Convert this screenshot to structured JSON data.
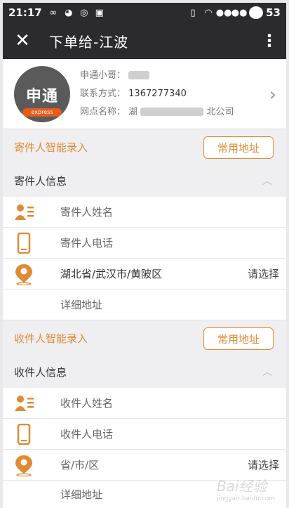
{
  "status": {
    "time": "21:17",
    "battery": "53"
  },
  "appbar": {
    "close": "✕",
    "title": "下单给-江波",
    "more": "⋮"
  },
  "courier": {
    "logo_text": "申通",
    "logo_sub": "express",
    "name_label": "申通小哥：",
    "phone_label": "联系方式：",
    "phone_value": "1367277340",
    "site_label": "网点名称：",
    "site_prefix": "湖",
    "site_suffix": "北公司"
  },
  "sender": {
    "smart_label": "寄件人智能录入",
    "common_address": "常用地址",
    "info_label": "寄件人信息",
    "name_placeholder": "寄件人姓名",
    "phone_placeholder": "寄件人电话",
    "region": "湖北省/武汉市/黄陂区",
    "region_action": "请选择",
    "address_placeholder": "详细地址"
  },
  "receiver": {
    "smart_label": "收件人智能录入",
    "common_address": "常用地址",
    "info_label": "收件人信息",
    "name_placeholder": "收件人姓名",
    "phone_placeholder": "收件人电话",
    "region": "省/市/区",
    "region_action": "请选择",
    "address_placeholder": "详细地址"
  },
  "watermark": {
    "text": "Bai经验",
    "sub": "jingyan.baidu.com"
  },
  "colors": {
    "accent": "#e08a33",
    "bar": "#2b2b2e"
  }
}
